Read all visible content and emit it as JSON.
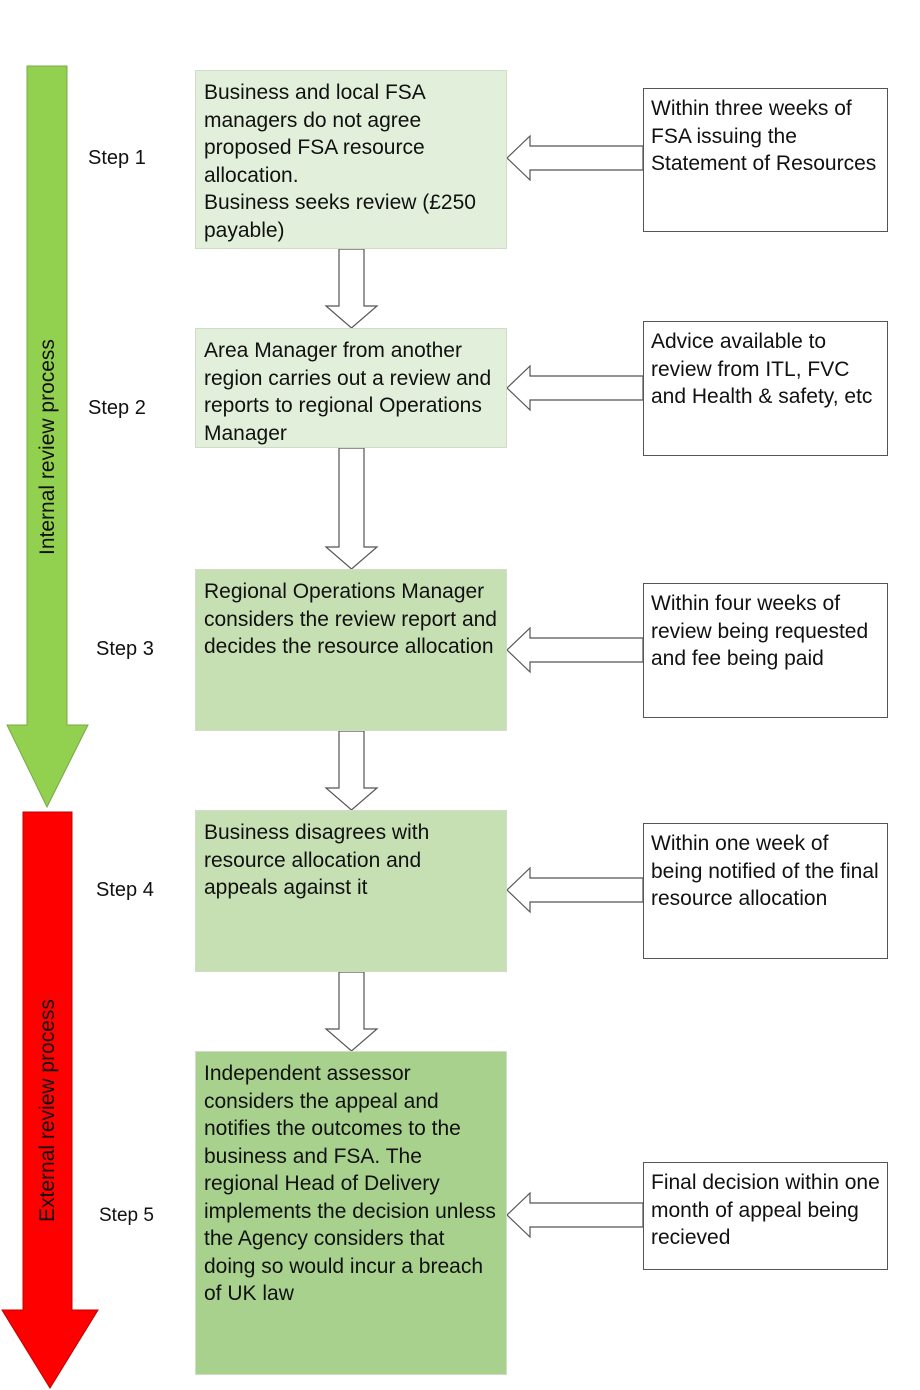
{
  "phases": [
    {
      "label": "Internal review process",
      "color": "#92d050"
    },
    {
      "label": "External review process",
      "color": "#ff0000"
    }
  ],
  "steps": [
    {
      "label": "Step 1",
      "text": "Business and local FSA managers do not agree proposed FSA resource allocation.\nBusiness seeks review (£250 payable)",
      "note": "Within three weeks of FSA issuing the Statement of Resources",
      "color": "#e2efda"
    },
    {
      "label": "Step 2",
      "text": "Area Manager from another region carries out a review and reports to regional Operations Manager",
      "note": "Advice available to review from ITL, FVC and Health & safety, etc",
      "color": "#e2efda"
    },
    {
      "label": "Step 3",
      "text": "Regional Operations Manager considers  the review report and decides the resource allocation",
      "note": "Within four weeks of review being requested and fee being paid",
      "color": "#c6e0b4"
    },
    {
      "label": "Step 4",
      "text": "Business disagrees with resource allocation and appeals against it",
      "note": "Within one week of being notified of the final resource allocation",
      "color": "#c6e0b4"
    },
    {
      "label": "Step 5",
      "text": "Independent assessor considers the appeal and notifies the outcomes to the business and FSA. The regional Head of Delivery implements the decision unless the Agency considers that doing so would incur a breach of UK law",
      "note": "Final decision within one month of appeal being recieved",
      "color": "#a9d18e"
    }
  ]
}
